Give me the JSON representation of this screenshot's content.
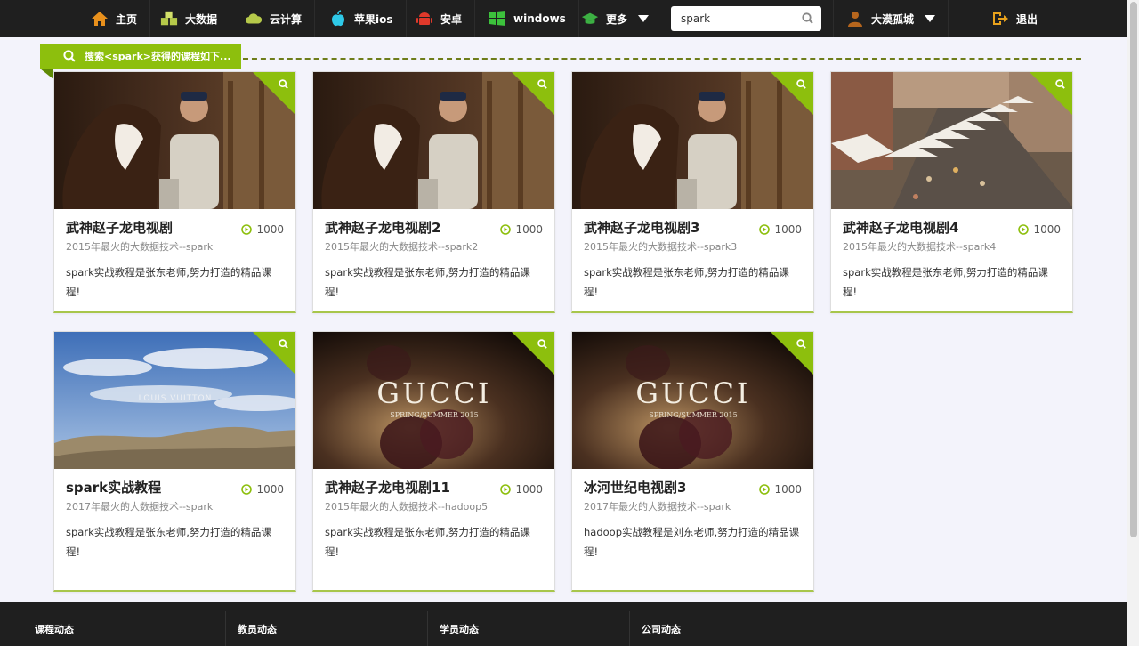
{
  "nav": {
    "home": "主页",
    "bigdata": "大数据",
    "cloud": "云计算",
    "ios": "苹果ios",
    "android": "安卓",
    "windows": "windows",
    "more": "更多",
    "search_value": "spark",
    "user": "大漠孤城",
    "logout": "退出"
  },
  "banner": {
    "text": "搜索<spark>获得的课程如下..."
  },
  "courses": [
    {
      "title": "武神赵子龙电视剧",
      "plays": "1000",
      "subtitle": "2015年最火的大数据技术--spark",
      "desc": "spark实战教程是张东老师,努力打造的精品课程!",
      "thumb": "horse-man"
    },
    {
      "title": "武神赵子龙电视剧2",
      "plays": "1000",
      "subtitle": "2015年最火的大数据技术--spark2",
      "desc": "spark实战教程是张东老师,努力打造的精品课程!",
      "thumb": "horse-man"
    },
    {
      "title": "武神赵子龙电视剧3",
      "plays": "1000",
      "subtitle": "2015年最火的大数据技术--spark3",
      "desc": "spark实战教程是张东老师,努力打造的精品课程!",
      "thumb": "horse-man"
    },
    {
      "title": "武神赵子龙电视剧4",
      "plays": "1000",
      "subtitle": "2015年最火的大数据技术--spark4",
      "desc": "spark实战教程是张东老师,努力打造的精品课程!",
      "thumb": "market"
    },
    {
      "title": "spark实战教程",
      "plays": "1000",
      "subtitle": "2017年最火的大数据技术--spark",
      "desc": "spark实战教程是张东老师,努力打造的精品课程!",
      "thumb": "sky",
      "thumb_text": "LOUIS VUITTON"
    },
    {
      "title": "武神赵子龙电视剧11",
      "plays": "1000",
      "subtitle": "2015年最火的大数据技术--hadoop5",
      "desc": "spark实战教程是张东老师,努力打造的精品课程!",
      "thumb": "gucci",
      "thumb_text": "GUCCI",
      "thumb_sub": "SPRING/SUMMER 2015"
    },
    {
      "title": "冰河世纪电视剧3",
      "plays": "1000",
      "subtitle": "2017年最火的大数据技术--spark",
      "desc": "hadoop实战教程是刘东老师,努力打造的精品课程!",
      "thumb": "gucci",
      "thumb_text": "GUCCI",
      "thumb_sub": "SPRING/SUMMER 2015"
    }
  ],
  "footer": {
    "courses": "课程动态",
    "teachers": "教员动态",
    "students": "学员动态",
    "company": "公司动态"
  },
  "colors": {
    "nav_bg": "#1f1f1f",
    "accent_green": "#8dbf0d",
    "page_bg": "#f3f3fb"
  }
}
